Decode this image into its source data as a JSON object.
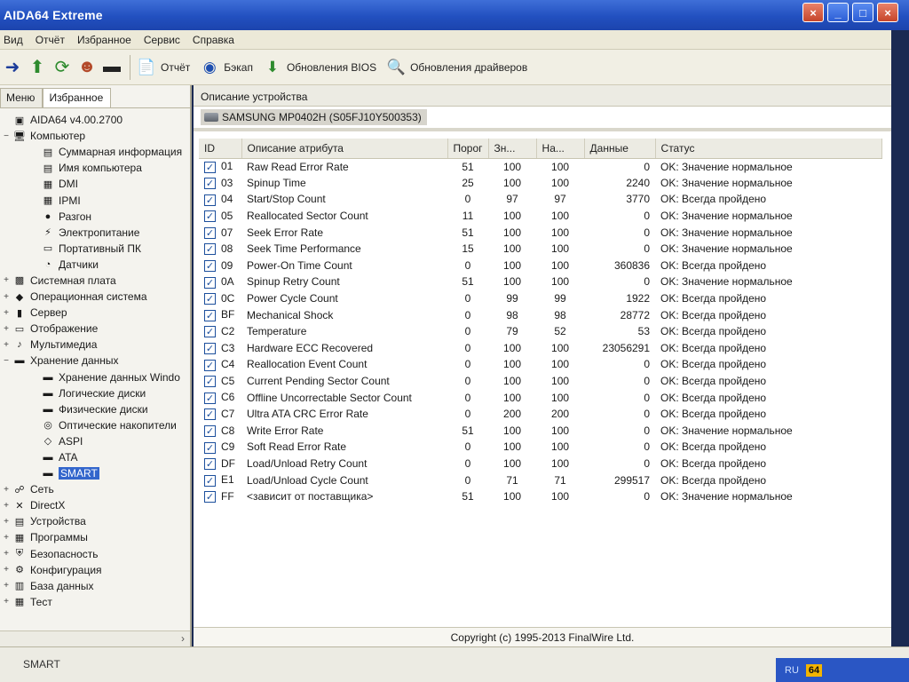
{
  "window": {
    "title": "AIDA64 Extreme"
  },
  "menu": [
    "Вид",
    "Отчёт",
    "Избранное",
    "Сервис",
    "Справка"
  ],
  "toolbar": {
    "buttons": [
      {
        "label": "Отчёт",
        "icon": "report-icon"
      },
      {
        "label": "Бэкап",
        "icon": "backup-icon"
      },
      {
        "label": "Обновления BIOS",
        "icon": "bios-update-icon"
      },
      {
        "label": "Обновления драйверов",
        "icon": "driver-update-icon"
      }
    ]
  },
  "left_pane": {
    "tabs": [
      "Меню",
      "Избранное"
    ],
    "tree": [
      {
        "label": "AIDA64 v4.00.2700",
        "level": 0,
        "icon": "aida-icon",
        "exp": ""
      },
      {
        "label": "Компьютер",
        "level": 0,
        "icon": "computer-icon",
        "exp": "−"
      },
      {
        "label": "Суммарная информация",
        "level": 1,
        "icon": "summary-icon",
        "exp": ""
      },
      {
        "label": "Имя компьютера",
        "level": 1,
        "icon": "computer-name-icon",
        "exp": ""
      },
      {
        "label": "DMI",
        "level": 1,
        "icon": "dmi-icon",
        "exp": ""
      },
      {
        "label": "IPMI",
        "level": 1,
        "icon": "ipmi-icon",
        "exp": ""
      },
      {
        "label": "Разгон",
        "level": 1,
        "icon": "overclock-icon",
        "exp": ""
      },
      {
        "label": "Электропитание",
        "level": 1,
        "icon": "power-icon",
        "exp": ""
      },
      {
        "label": "Портативный ПК",
        "level": 1,
        "icon": "laptop-icon",
        "exp": ""
      },
      {
        "label": "Датчики",
        "level": 1,
        "icon": "sensor-icon",
        "exp": ""
      },
      {
        "label": "Системная плата",
        "level": 0,
        "icon": "motherboard-icon",
        "exp": "+"
      },
      {
        "label": "Операционная система",
        "level": 0,
        "icon": "os-icon",
        "exp": "+"
      },
      {
        "label": "Сервер",
        "level": 0,
        "icon": "server-icon",
        "exp": "+"
      },
      {
        "label": "Отображение",
        "level": 0,
        "icon": "display-icon",
        "exp": "+"
      },
      {
        "label": "Мультимедиа",
        "level": 0,
        "icon": "multimedia-icon",
        "exp": "+"
      },
      {
        "label": "Хранение данных",
        "level": 0,
        "icon": "storage-icon",
        "exp": "−"
      },
      {
        "label": "Хранение данных Windo",
        "level": 1,
        "icon": "windows-storage-icon",
        "exp": ""
      },
      {
        "label": "Логические диски",
        "level": 1,
        "icon": "logical-disk-icon",
        "exp": ""
      },
      {
        "label": "Физические диски",
        "level": 1,
        "icon": "physical-disk-icon",
        "exp": ""
      },
      {
        "label": "Оптические накопители",
        "level": 1,
        "icon": "optical-drive-icon",
        "exp": ""
      },
      {
        "label": "ASPI",
        "level": 1,
        "icon": "aspi-icon",
        "exp": ""
      },
      {
        "label": "ATA",
        "level": 1,
        "icon": "ata-icon",
        "exp": ""
      },
      {
        "label": "SMART",
        "level": 1,
        "icon": "smart-icon",
        "exp": "",
        "selected": true
      },
      {
        "label": "Сеть",
        "level": 0,
        "icon": "network-icon",
        "exp": "+"
      },
      {
        "label": "DirectX",
        "level": 0,
        "icon": "directx-icon",
        "exp": "+"
      },
      {
        "label": "Устройства",
        "level": 0,
        "icon": "devices-icon",
        "exp": "+"
      },
      {
        "label": "Программы",
        "level": 0,
        "icon": "programs-icon",
        "exp": "+"
      },
      {
        "label": "Безопасность",
        "level": 0,
        "icon": "security-icon",
        "exp": "+"
      },
      {
        "label": "Конфигурация",
        "level": 0,
        "icon": "config-icon",
        "exp": "+"
      },
      {
        "label": "База данных",
        "level": 0,
        "icon": "database-icon",
        "exp": "+"
      },
      {
        "label": "Тест",
        "level": 0,
        "icon": "benchmark-icon",
        "exp": "+"
      }
    ]
  },
  "main": {
    "section_title": "Описание устройства",
    "device": "SAMSUNG MP0402H (S05FJ10Y500353)",
    "columns": [
      "ID",
      "Описание атрибута",
      "Порог",
      "Зн...",
      "На...",
      "Данные",
      "Статус"
    ],
    "rows": [
      [
        "01",
        "Raw Read Error Rate",
        "51",
        "100",
        "100",
        "0",
        "OK: Значение нормальное"
      ],
      [
        "03",
        "Spinup Time",
        "25",
        "100",
        "100",
        "2240",
        "OK: Значение нормальное"
      ],
      [
        "04",
        "Start/Stop Count",
        "0",
        "97",
        "97",
        "3770",
        "OK: Всегда пройдено"
      ],
      [
        "05",
        "Reallocated Sector Count",
        "11",
        "100",
        "100",
        "0",
        "OK: Значение нормальное"
      ],
      [
        "07",
        "Seek Error Rate",
        "51",
        "100",
        "100",
        "0",
        "OK: Значение нормальное"
      ],
      [
        "08",
        "Seek Time Performance",
        "15",
        "100",
        "100",
        "0",
        "OK: Значение нормальное"
      ],
      [
        "09",
        "Power-On Time Count",
        "0",
        "100",
        "100",
        "360836",
        "OK: Всегда пройдено"
      ],
      [
        "0A",
        "Spinup Retry Count",
        "51",
        "100",
        "100",
        "0",
        "OK: Значение нормальное"
      ],
      [
        "0C",
        "Power Cycle Count",
        "0",
        "99",
        "99",
        "1922",
        "OK: Всегда пройдено"
      ],
      [
        "BF",
        "Mechanical Shock",
        "0",
        "98",
        "98",
        "28772",
        "OK: Всегда пройдено"
      ],
      [
        "C2",
        "Temperature",
        "0",
        "79",
        "52",
        "53",
        "OK: Всегда пройдено"
      ],
      [
        "C3",
        "Hardware ECC Recovered",
        "0",
        "100",
        "100",
        "23056291",
        "OK: Всегда пройдено"
      ],
      [
        "C4",
        "Reallocation Event Count",
        "0",
        "100",
        "100",
        "0",
        "OK: Всегда пройдено"
      ],
      [
        "C5",
        "Current Pending Sector Count",
        "0",
        "100",
        "100",
        "0",
        "OK: Всегда пройдено"
      ],
      [
        "C6",
        "Offline Uncorrectable Sector Count",
        "0",
        "100",
        "100",
        "0",
        "OK: Всегда пройдено"
      ],
      [
        "C7",
        "Ultra ATA CRC Error Rate",
        "0",
        "200",
        "200",
        "0",
        "OK: Всегда пройдено"
      ],
      [
        "C8",
        "Write Error Rate",
        "51",
        "100",
        "100",
        "0",
        "OK: Значение нормальное"
      ],
      [
        "C9",
        "Soft Read Error Rate",
        "0",
        "100",
        "100",
        "0",
        "OK: Всегда пройдено"
      ],
      [
        "DF",
        "Load/Unload Retry Count",
        "0",
        "100",
        "100",
        "0",
        "OK: Всегда пройдено"
      ],
      [
        "E1",
        "Load/Unload Cycle Count",
        "0",
        "71",
        "71",
        "299517",
        "OK: Всегда пройдено"
      ],
      [
        "FF",
        "<зависит от поставщика>",
        "51",
        "100",
        "100",
        "0",
        "OK: Значение нормальное"
      ]
    ],
    "copyright": "Copyright (c) 1995-2013 FinalWire Ltd."
  },
  "statusbar": {
    "text": "SMART",
    "lang": "RU",
    "tray_badge": "64"
  }
}
